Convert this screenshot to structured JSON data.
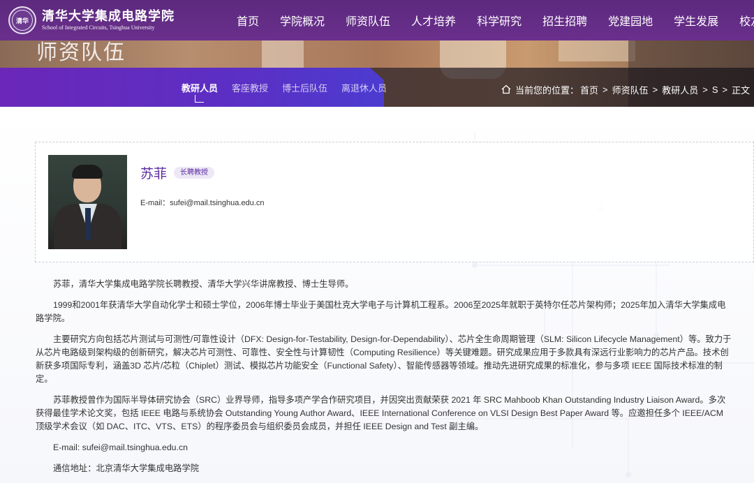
{
  "header": {
    "logo_seal": "清华",
    "logo_cn": "清华大学集成电路学院",
    "logo_en": "School of Integrated Circuits, Tsinghua University",
    "nav": [
      "首页",
      "学院概况",
      "师资队伍",
      "人才培养",
      "科学研究",
      "招生招聘",
      "党建园地",
      "学生发展",
      "校友之窗"
    ]
  },
  "banner": {
    "title": "师资队伍"
  },
  "subnav": {
    "items": [
      "教研人员",
      "客座教授",
      "博士后队伍",
      "离退休人员"
    ],
    "active": "教研人员"
  },
  "breadcrumb": {
    "label": "当前您的位置：",
    "items": [
      "首页",
      "师资队伍",
      "教研人员",
      "S",
      "正文"
    ],
    "separator": ">"
  },
  "profile": {
    "name": "苏菲",
    "title_badge": "长聘教授",
    "email_label": "E-mail：",
    "email": "sufei@mail.tsinghua.edu.cn"
  },
  "article": {
    "paragraphs": [
      "苏菲，清华大学集成电路学院长聘教授、清华大学兴华讲席教授、博士生导师。",
      "1999和2001年获清华大学自动化学士和硕士学位，2006年博士毕业于美国杜克大学电子与计算机工程系。2006至2025年就职于英特尔任芯片架构师；2025年加入清华大学集成电路学院。",
      "主要研究方向包括芯片测试与可测性/可靠性设计（DFX: Design-for-Testability, Design-for-Dependability）、芯片全生命周期管理（SLM: Silicon Lifecycle Management）等。致力于从芯片电路级到架构级的创新研究，解决芯片可测性、可靠性、安全性与计算韧性（Computing Resilience）等关键难题。研究成果应用于多款具有深远行业影响力的芯片产品。技术创新获多项国际专利，涵盖3D 芯片/芯粒（Chiplet）测试、模拟芯片功能安全（Functional Safety）、智能传感器等领域。推动先进研究成果的标准化，参与多项 IEEE 国际技术标准的制定。",
      "苏菲教授曾作为国际半导体研究协会（SRC）业界导师，指导多项产学合作研究项目，并因突出贡献荣获 2021 年 SRC Mahboob Khan Outstanding Industry Liaison Award。多次获得最佳学术论文奖，包括 IEEE 电路与系统协会 Outstanding Young Author Award、IEEE International Conference on VLSI Design Best Paper Award 等。应邀担任多个 IEEE/ACM 顶级学术会议（如 DAC、ITC、VTS、ETS）的程序委员会与组织委员会成员，并担任 IEEE Design and Test 副主编。",
      "E-mail: sufei@mail.tsinghua.edu.cn",
      "通信地址：北京清华大学集成电路学院"
    ]
  },
  "colors": {
    "header_purple": "#5c2a7e",
    "accent_purple": "#5b2ba0",
    "subnav_purple": "#6a27b8"
  }
}
